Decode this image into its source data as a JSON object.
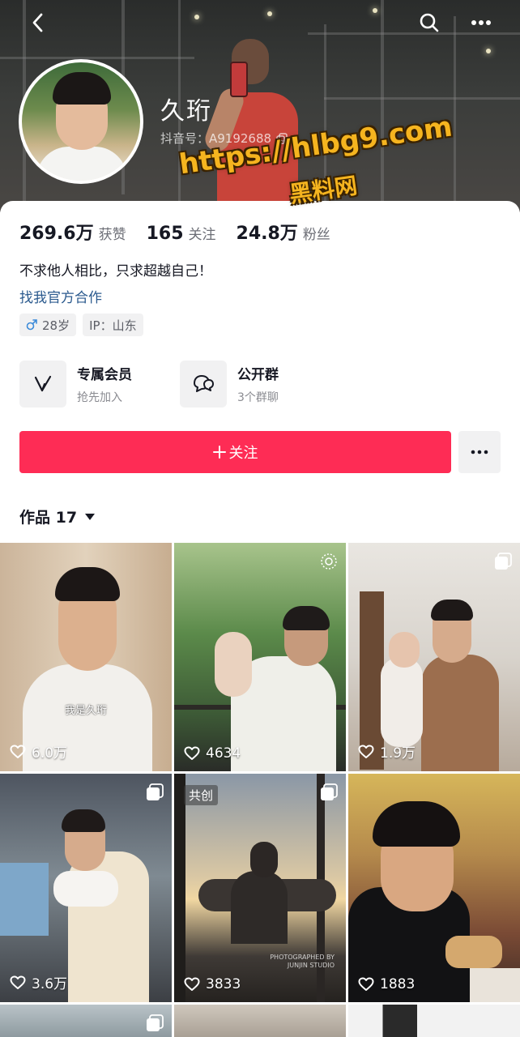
{
  "profile": {
    "username": "久珩",
    "douyin_id": "抖音号：A9192688",
    "watermark_url": "https://hlbg9.com",
    "watermark_sub": "黑料网"
  },
  "stats": [
    {
      "value": "269.6万",
      "label": "获赞"
    },
    {
      "value": "165",
      "label": "关注"
    },
    {
      "value": "24.8万",
      "label": "粉丝"
    }
  ],
  "bio": {
    "text": "不求他人相比，只求超越自己！",
    "link": "找我官方合作",
    "tags": [
      "28岁",
      "IP：山东"
    ],
    "gender_icon": "male-icon"
  },
  "tiles": [
    {
      "title": "专属会员",
      "sub": "抢先加入",
      "icon": "member-v-icon"
    },
    {
      "title": "公开群",
      "sub": "3个群聊",
      "icon": "group-chat-icon"
    }
  ],
  "actions": {
    "follow_label": "关注",
    "works_label": "作品 17"
  },
  "grid": [
    {
      "likes": "6.0万",
      "caption": "我是久珩"
    },
    {
      "likes": "4634"
    },
    {
      "likes": "1.9万"
    },
    {
      "likes": "3.6万"
    },
    {
      "likes": "3833",
      "badge": "共创",
      "studio": "PHOTOGRAPHED BY JUNJIN STUDIO"
    },
    {
      "likes": "1883"
    }
  ],
  "colors": {
    "accent": "#fe2c55",
    "link": "#2b5a8e",
    "watermark": "#f5b41f"
  }
}
